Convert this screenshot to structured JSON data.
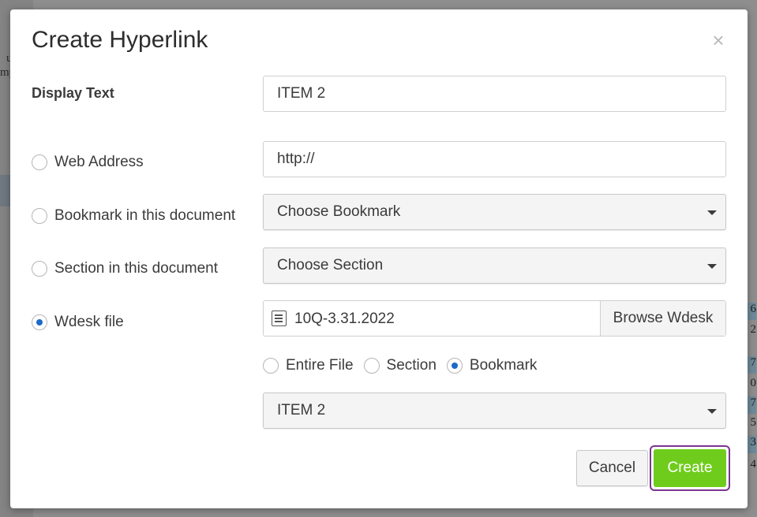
{
  "background": {
    "fragments": [
      "u",
      "mp"
    ],
    "numbers": [
      "6",
      "2",
      "7",
      "0",
      "7",
      "5",
      "3",
      "4"
    ]
  },
  "dialog": {
    "title": "Create Hyperlink",
    "close_glyph": "×",
    "display_text": {
      "label": "Display Text",
      "value": "ITEM 2"
    },
    "web_address": {
      "label": "Web Address",
      "value": "http://",
      "selected": false
    },
    "bookmark_in_doc": {
      "label": "Bookmark in this document",
      "selected_value": "Choose Bookmark",
      "selected": false
    },
    "section_in_doc": {
      "label": "Section in this document",
      "selected_value": "Choose Section",
      "selected": false
    },
    "wdesk_file": {
      "label": "Wdesk file",
      "selected": true,
      "file_icon": "document-icon",
      "file_name": "10Q-3.31.2022",
      "browse_label": "Browse Wdesk",
      "scope_options": [
        {
          "label": "Entire File",
          "selected": false
        },
        {
          "label": "Section",
          "selected": false
        },
        {
          "label": "Bookmark",
          "selected": true
        }
      ],
      "bookmark_select_value": "ITEM 2"
    },
    "buttons": {
      "cancel": "Cancel",
      "create": "Create"
    },
    "colors": {
      "accent": "#1b6ac9",
      "create_bg": "#6fcc1c",
      "focus_ring": "#7a3591"
    }
  }
}
